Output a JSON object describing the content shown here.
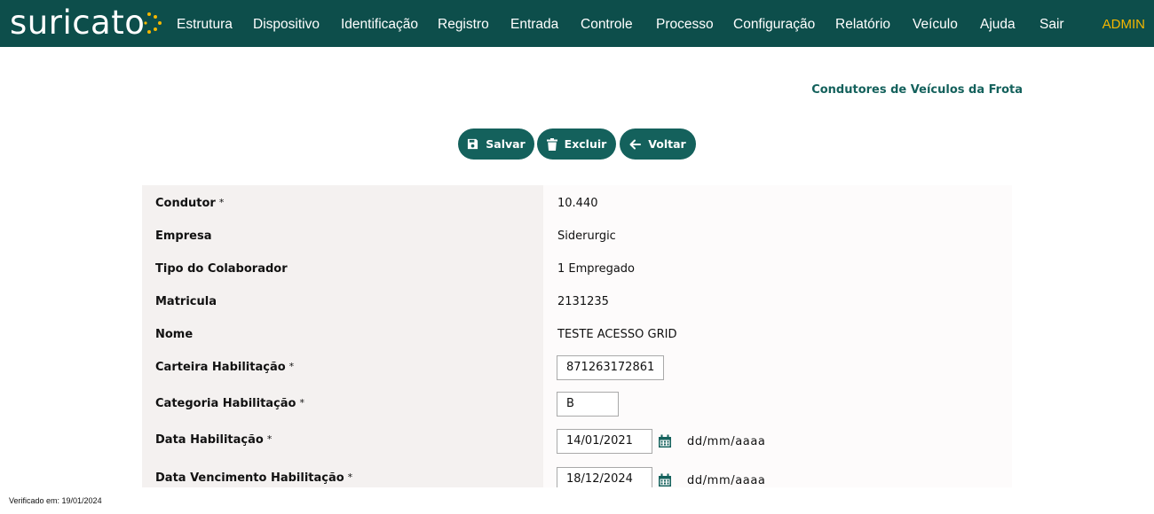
{
  "app": {
    "logo_text": "suricato",
    "user": "ADMIN"
  },
  "nav": [
    {
      "label": "Estrutura"
    },
    {
      "label": "Dispositivo"
    },
    {
      "label": "Identificação"
    },
    {
      "label": "Registro"
    },
    {
      "label": "Entrada"
    },
    {
      "label": "Controle"
    },
    {
      "label": "Processo"
    },
    {
      "label": "Configuração"
    },
    {
      "label": "Relatório"
    },
    {
      "label": "Veículo"
    },
    {
      "label": "Ajuda"
    },
    {
      "label": "Sair"
    }
  ],
  "page": {
    "title": "Condutores de Veículos da Frota"
  },
  "actions": {
    "save_label": "Salvar",
    "delete_label": "Excluir",
    "back_label": "Voltar"
  },
  "form": {
    "required_mark": "*",
    "rows": [
      {
        "label": "Condutor",
        "value": "10.440"
      },
      {
        "label": "Empresa",
        "value": "Siderurgic"
      },
      {
        "label": "Tipo do Colaborador",
        "value": "1 Empregado"
      },
      {
        "label": "Matricula",
        "value": "2131235"
      },
      {
        "label": "Nome",
        "value": "TESTE ACESSO GRID"
      },
      {
        "label": "Carteira Habilitação",
        "value": "871263172861"
      },
      {
        "label": "Categoria Habilitação",
        "value": "B"
      },
      {
        "label": "Data Habilitação",
        "value": "14/01/2021",
        "format": "dd/mm/aaaa"
      },
      {
        "label": "Data Vencimento Habilitação",
        "value": "18/12/2024",
        "format": "dd/mm/aaaa"
      }
    ]
  },
  "footer": {
    "verified": "Verificado em: 19/01/2024"
  },
  "colors": {
    "nav_bg": "#0d4e4b",
    "accent": "#14615c",
    "admin": "#f4b700",
    "logo_dot": "#f4b700"
  }
}
